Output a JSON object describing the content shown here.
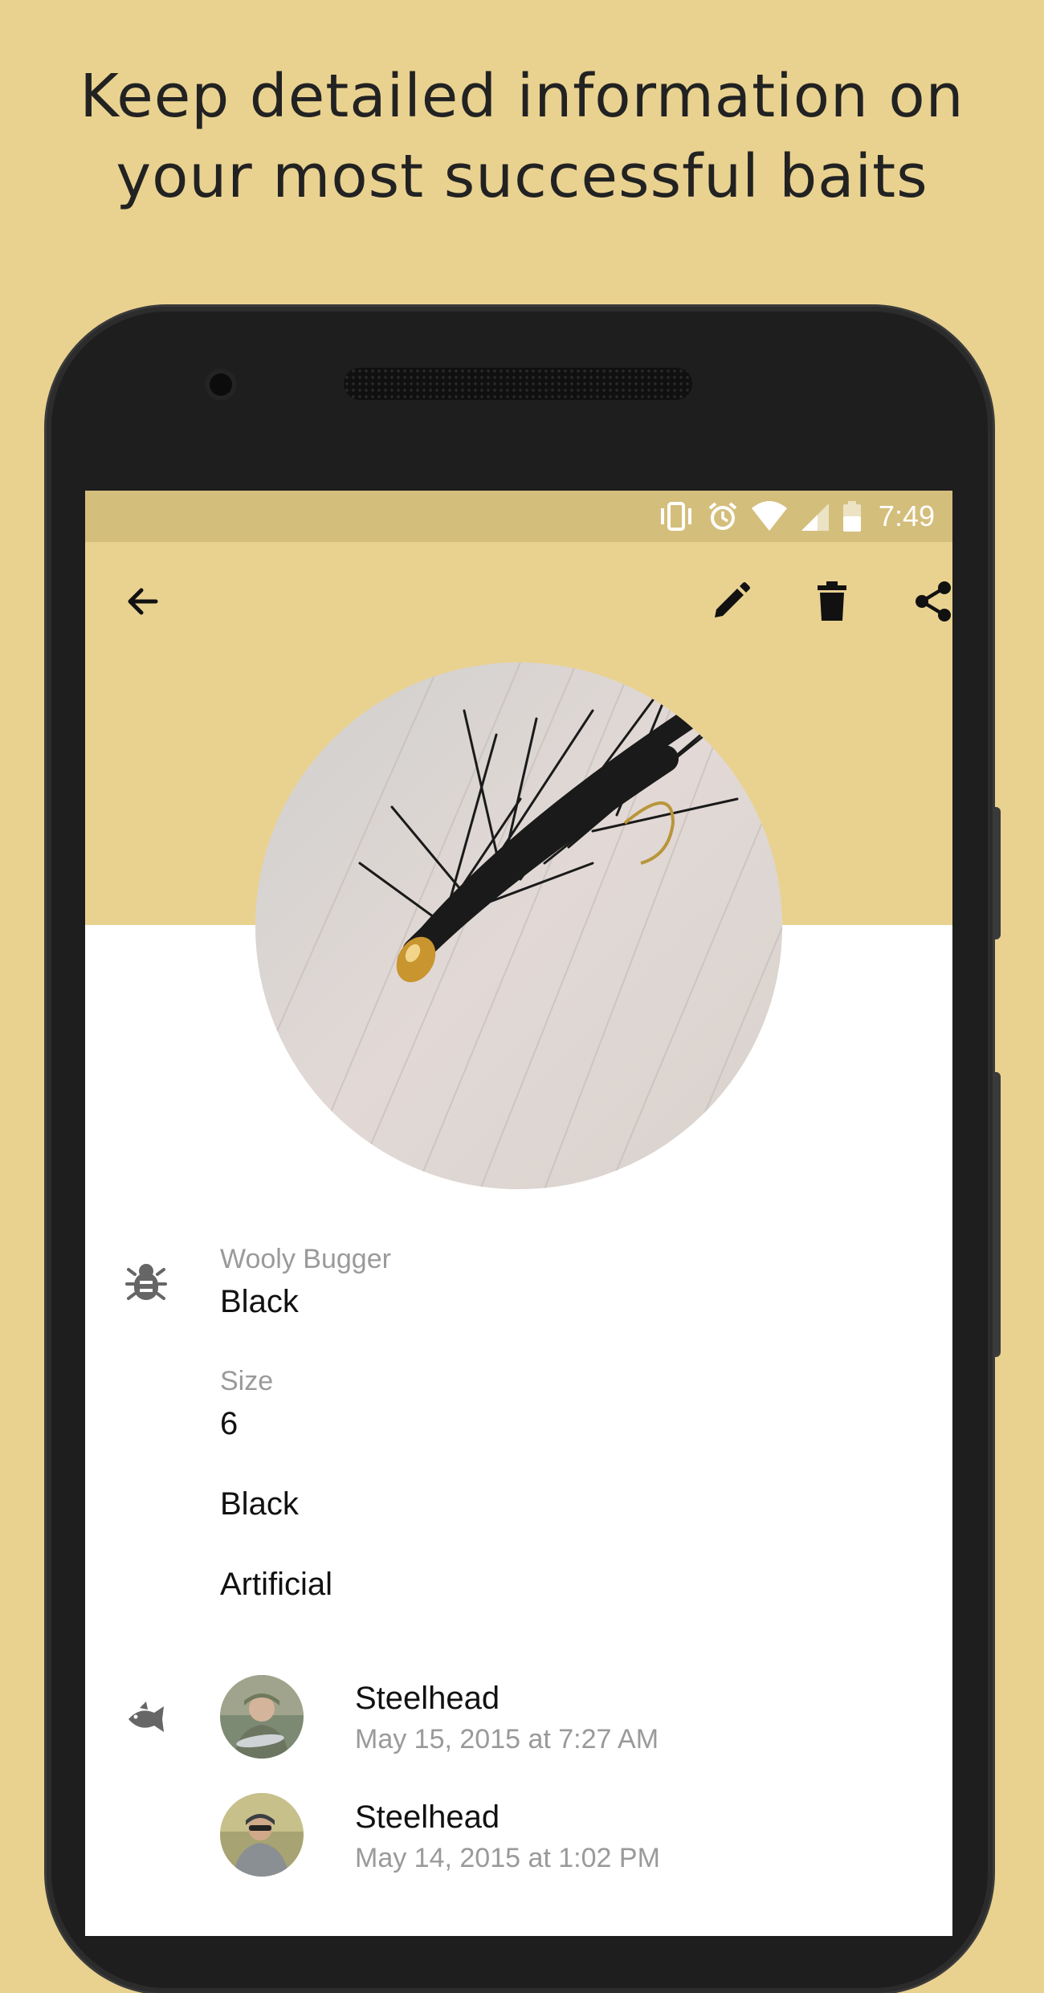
{
  "headline": {
    "line1": "Keep detailed information on",
    "line2": "your most successful baits"
  },
  "status_bar": {
    "time": "7:49",
    "icons": [
      "vibrate-icon",
      "alarm-icon",
      "wifi-icon",
      "signal-icon",
      "battery-icon"
    ]
  },
  "toolbar": {
    "back_icon": "arrow-back-icon",
    "actions": [
      "edit-icon",
      "delete-icon",
      "share-icon"
    ]
  },
  "bait": {
    "photo_icon": "fly-lure-photo",
    "category_label": "Wooly Bugger",
    "name": "Black",
    "size_label": "Size",
    "size_value": "6",
    "color": "Black",
    "type": "Artificial"
  },
  "catches": [
    {
      "species": "Steelhead",
      "date": "May 15, 2015 at 7:27 AM"
    },
    {
      "species": "Steelhead",
      "date": "May 14, 2015 at 1:02 PM"
    }
  ],
  "colors": {
    "accent": "#E9D290",
    "status_bar": "#D4BE7C",
    "icon_gray": "#666666"
  }
}
